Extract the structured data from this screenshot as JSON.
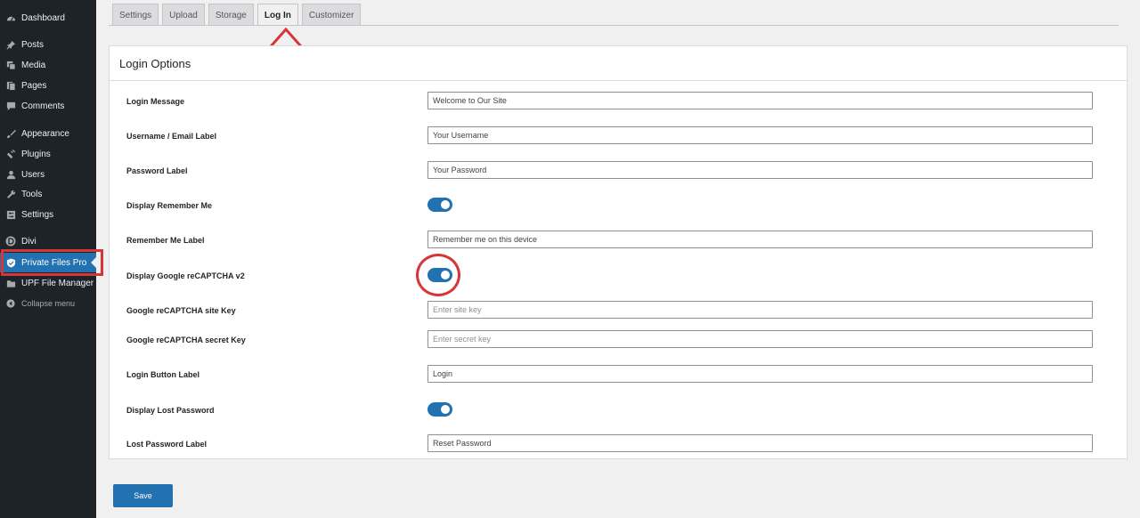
{
  "sidebar": {
    "items": [
      {
        "label": "Dashboard",
        "icon": "dashboard-icon"
      },
      {
        "label": "Posts",
        "icon": "pin-icon"
      },
      {
        "label": "Media",
        "icon": "media-icon"
      },
      {
        "label": "Pages",
        "icon": "pages-icon"
      },
      {
        "label": "Comments",
        "icon": "comment-icon"
      },
      {
        "label": "Appearance",
        "icon": "brush-icon"
      },
      {
        "label": "Plugins",
        "icon": "plug-icon"
      },
      {
        "label": "Users",
        "icon": "user-icon"
      },
      {
        "label": "Tools",
        "icon": "wrench-icon"
      },
      {
        "label": "Settings",
        "icon": "settings-icon"
      },
      {
        "label": "Divi",
        "icon": "divi-icon"
      },
      {
        "label": "Private Files Pro",
        "icon": "shield-icon"
      },
      {
        "label": "UPF File Manager",
        "icon": "folder-icon"
      },
      {
        "label": "Collapse menu",
        "icon": "collapse-icon"
      }
    ]
  },
  "tabs": [
    {
      "label": "Settings",
      "active": false
    },
    {
      "label": "Upload",
      "active": false
    },
    {
      "label": "Storage",
      "active": false
    },
    {
      "label": "Log In",
      "active": true
    },
    {
      "label": "Customizer",
      "active": false
    }
  ],
  "panel": {
    "title": "Login Options",
    "rows": [
      {
        "label": "Login Message",
        "type": "text",
        "value": "Welcome to Our Site",
        "placeholder": ""
      },
      {
        "label": "Username / Email Label",
        "type": "text",
        "value": "Your Username",
        "placeholder": ""
      },
      {
        "label": "Password Label",
        "type": "text",
        "value": "Your Password",
        "placeholder": ""
      },
      {
        "label": "Display Remember Me",
        "type": "toggle",
        "on": true
      },
      {
        "label": "Remember Me Label",
        "type": "text",
        "value": "Remember me on this device",
        "placeholder": ""
      },
      {
        "label": "Display Google reCAPTCHA v2",
        "type": "toggle",
        "on": true
      },
      {
        "label": "Google reCAPTCHA site Key",
        "type": "text",
        "value": "",
        "placeholder": "Enter site key"
      },
      {
        "label": "Google reCAPTCHA secret Key",
        "type": "text",
        "value": "",
        "placeholder": "Enter secret key"
      },
      {
        "label": "Login Button Label",
        "type": "text",
        "value": "Login",
        "placeholder": ""
      },
      {
        "label": "Display Lost Password",
        "type": "toggle",
        "on": true
      },
      {
        "label": "Lost Password Label",
        "type": "text",
        "value": "Reset Password",
        "placeholder": ""
      }
    ]
  },
  "save_label": "Save",
  "colors": {
    "sidebar_bg": "#1d2327",
    "accent": "#2271b1",
    "annotation": "#d63638"
  }
}
